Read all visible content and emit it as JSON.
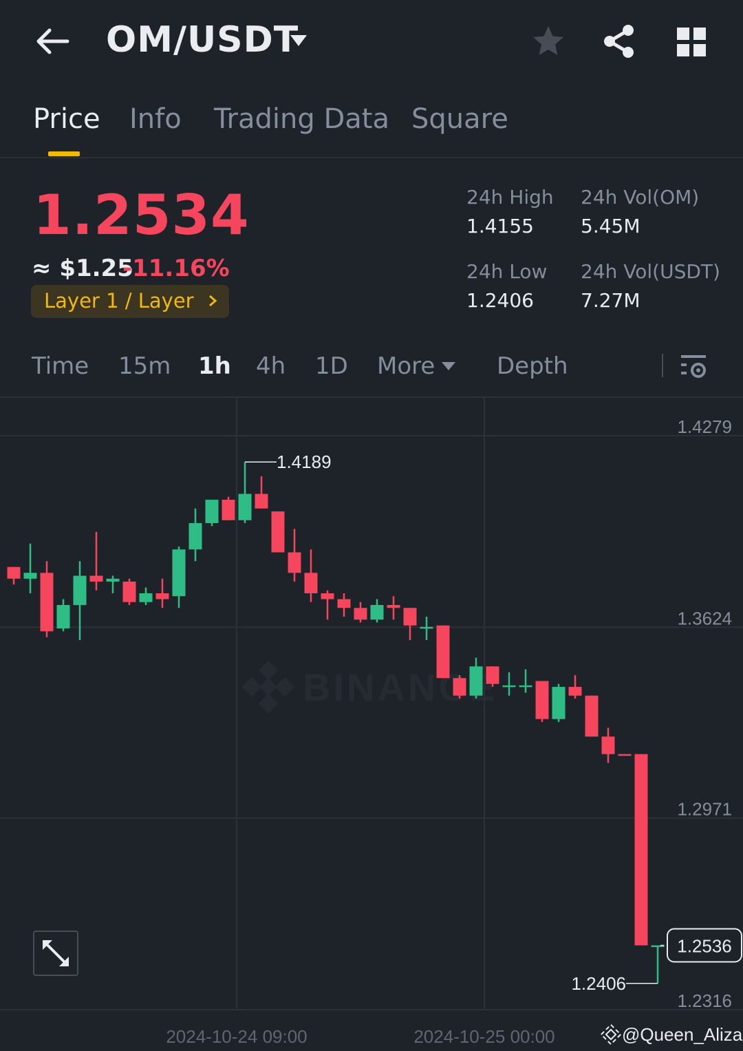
{
  "header": {
    "pair": "OM/USDT",
    "icons": {
      "back": "arrow-left-icon",
      "caret": "caret-down-icon",
      "favorite": "star-icon",
      "share": "share-icon",
      "menu": "grid-icon"
    }
  },
  "tabs": [
    {
      "label": "Price",
      "active": true
    },
    {
      "label": "Info",
      "active": false
    },
    {
      "label": "Trading Data",
      "active": false
    },
    {
      "label": "Square",
      "active": false
    }
  ],
  "ticker": {
    "last_price": "1.2534",
    "usd_price": "≈ $1.25",
    "change_pct": "-11.16%",
    "tag": "Layer 1 / Layer",
    "high_label": "24h High",
    "high_value": "1.4155",
    "vol_base_label": "24h Vol(OM)",
    "vol_base_value": "5.45M",
    "low_label": "24h Low",
    "low_value": "1.2406",
    "vol_quote_label": "24h Vol(USDT)",
    "vol_quote_value": "7.27M"
  },
  "intervals": [
    {
      "label": "Time",
      "active": false
    },
    {
      "label": "15m",
      "active": false
    },
    {
      "label": "1h",
      "active": true
    },
    {
      "label": "4h",
      "active": false
    },
    {
      "label": "1D",
      "active": false
    },
    {
      "label": "More",
      "active": false
    },
    {
      "label": "Depth",
      "active": false
    }
  ],
  "colors": {
    "up": "#2ebd85",
    "down": "#f6465d",
    "accent": "#f0b90b",
    "background": "#1e2329"
  },
  "chart_data": {
    "type": "candlestick",
    "interval": "1h",
    "ylim": [
      1.2316,
      1.4279
    ],
    "y_ticks": [
      "1.4279",
      "1.3624",
      "1.2971",
      "1.2316"
    ],
    "x_ticks": [
      "2024-10-24 09:00",
      "2024-10-25 00:00"
    ],
    "max_label": "1.4189",
    "min_label": "1.2406",
    "current_label": "1.2536",
    "watermark": "BINANCE",
    "credit": "@Queen_Aliza",
    "candles": [
      {
        "o": 1.383,
        "h": 1.383,
        "l": 1.377,
        "c": 1.379
      },
      {
        "o": 1.379,
        "h": 1.391,
        "l": 1.374,
        "c": 1.381
      },
      {
        "o": 1.381,
        "h": 1.385,
        "l": 1.359,
        "c": 1.361
      },
      {
        "o": 1.362,
        "h": 1.372,
        "l": 1.361,
        "c": 1.37
      },
      {
        "o": 1.37,
        "h": 1.385,
        "l": 1.358,
        "c": 1.38
      },
      {
        "o": 1.38,
        "h": 1.395,
        "l": 1.375,
        "c": 1.378
      },
      {
        "o": 1.378,
        "h": 1.38,
        "l": 1.374,
        "c": 1.379
      },
      {
        "o": 1.378,
        "h": 1.379,
        "l": 1.37,
        "c": 1.371
      },
      {
        "o": 1.371,
        "h": 1.376,
        "l": 1.37,
        "c": 1.374
      },
      {
        "o": 1.374,
        "h": 1.379,
        "l": 1.369,
        "c": 1.372
      },
      {
        "o": 1.373,
        "h": 1.39,
        "l": 1.369,
        "c": 1.389
      },
      {
        "o": 1.389,
        "h": 1.403,
        "l": 1.385,
        "c": 1.398
      },
      {
        "o": 1.398,
        "h": 1.406,
        "l": 1.397,
        "c": 1.406
      },
      {
        "o": 1.406,
        "h": 1.407,
        "l": 1.399,
        "c": 1.399
      },
      {
        "o": 1.399,
        "h": 1.4189,
        "l": 1.398,
        "c": 1.408
      },
      {
        "o": 1.408,
        "h": 1.414,
        "l": 1.403,
        "c": 1.403
      },
      {
        "o": 1.402,
        "h": 1.402,
        "l": 1.388,
        "c": 1.388
      },
      {
        "o": 1.388,
        "h": 1.396,
        "l": 1.378,
        "c": 1.381
      },
      {
        "o": 1.381,
        "h": 1.389,
        "l": 1.371,
        "c": 1.374
      },
      {
        "o": 1.374,
        "h": 1.375,
        "l": 1.365,
        "c": 1.372
      },
      {
        "o": 1.372,
        "h": 1.374,
        "l": 1.366,
        "c": 1.369
      },
      {
        "o": 1.369,
        "h": 1.371,
        "l": 1.364,
        "c": 1.365
      },
      {
        "o": 1.365,
        "h": 1.372,
        "l": 1.364,
        "c": 1.37
      },
      {
        "o": 1.37,
        "h": 1.373,
        "l": 1.365,
        "c": 1.369
      },
      {
        "o": 1.369,
        "h": 1.369,
        "l": 1.358,
        "c": 1.363
      },
      {
        "o": 1.362,
        "h": 1.366,
        "l": 1.358,
        "c": 1.3625
      },
      {
        "o": 1.363,
        "h": 1.363,
        "l": 1.345,
        "c": 1.345
      },
      {
        "o": 1.345,
        "h": 1.346,
        "l": 1.338,
        "c": 1.339
      },
      {
        "o": 1.339,
        "h": 1.352,
        "l": 1.338,
        "c": 1.349
      },
      {
        "o": 1.349,
        "h": 1.349,
        "l": 1.342,
        "c": 1.343
      },
      {
        "o": 1.342,
        "h": 1.347,
        "l": 1.339,
        "c": 1.3425
      },
      {
        "o": 1.342,
        "h": 1.348,
        "l": 1.34,
        "c": 1.3425
      },
      {
        "o": 1.344,
        "h": 1.344,
        "l": 1.33,
        "c": 1.331
      },
      {
        "o": 1.331,
        "h": 1.343,
        "l": 1.33,
        "c": 1.342
      },
      {
        "o": 1.342,
        "h": 1.346,
        "l": 1.338,
        "c": 1.339
      },
      {
        "o": 1.339,
        "h": 1.339,
        "l": 1.325,
        "c": 1.325
      },
      {
        "o": 1.325,
        "h": 1.328,
        "l": 1.316,
        "c": 1.319
      },
      {
        "o": 1.319,
        "h": 1.319,
        "l": 1.3185,
        "c": 1.3188
      },
      {
        "o": 1.319,
        "h": 1.319,
        "l": 1.256,
        "c": 1.2536
      },
      {
        "o": 1.2536,
        "h": 1.2536,
        "l": 1.2406,
        "c": 1.2536
      }
    ]
  }
}
